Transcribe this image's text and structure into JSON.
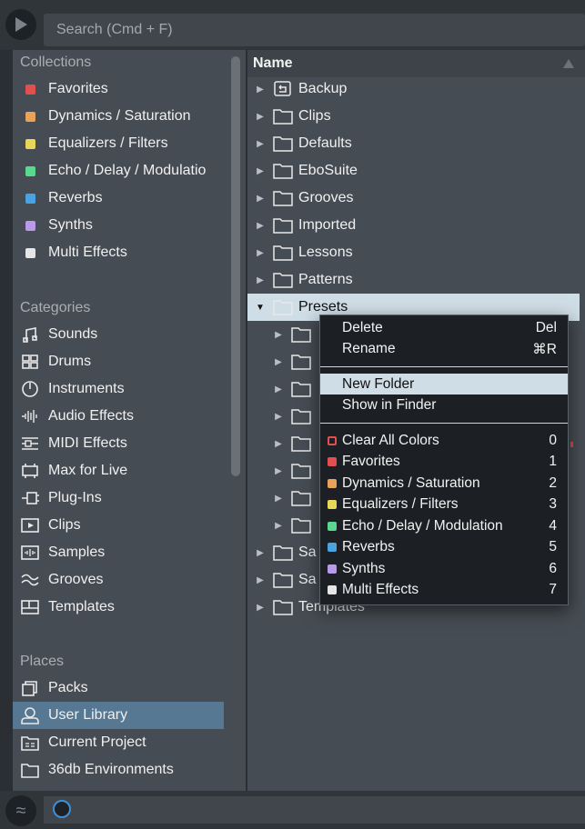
{
  "search": {
    "placeholder": "Search (Cmd + F)"
  },
  "collections": {
    "title": "Collections",
    "items": [
      {
        "label": "Favorites",
        "color": "#e05050"
      },
      {
        "label": "Dynamics / Saturation",
        "color": "#e8a25a"
      },
      {
        "label": "Equalizers / Filters",
        "color": "#e8d85a"
      },
      {
        "label": "Echo / Delay / Modulatio",
        "color": "#5ad88e"
      },
      {
        "label": "Reverbs",
        "color": "#4aa3e0"
      },
      {
        "label": "Synths",
        "color": "#b89ae8"
      },
      {
        "label": "Multi Effects",
        "color": "#e6e6e6"
      }
    ]
  },
  "categories": {
    "title": "Categories",
    "items": [
      {
        "label": "Sounds",
        "icon": "sounds-icon"
      },
      {
        "label": "Drums",
        "icon": "drums-icon"
      },
      {
        "label": "Instruments",
        "icon": "instruments-icon"
      },
      {
        "label": "Audio Effects",
        "icon": "audio-effects-icon"
      },
      {
        "label": "MIDI Effects",
        "icon": "midi-effects-icon"
      },
      {
        "label": "Max for Live",
        "icon": "max-for-live-icon"
      },
      {
        "label": "Plug-Ins",
        "icon": "plug-ins-icon"
      },
      {
        "label": "Clips",
        "icon": "clips-icon"
      },
      {
        "label": "Samples",
        "icon": "samples-icon"
      },
      {
        "label": "Grooves",
        "icon": "grooves-icon"
      },
      {
        "label": "Templates",
        "icon": "templates-icon"
      }
    ]
  },
  "places": {
    "title": "Places",
    "items": [
      {
        "label": "Packs",
        "icon": "packs-icon"
      },
      {
        "label": "User Library",
        "icon": "user-icon",
        "selected": true
      },
      {
        "label": "Current Project",
        "icon": "project-icon"
      },
      {
        "label": "36db Environments",
        "icon": "folder-icon"
      }
    ]
  },
  "files": {
    "header": "Name",
    "top": [
      {
        "label": "Backup",
        "icon": "backup-icon"
      },
      {
        "label": "Clips",
        "icon": "folder-icon"
      },
      {
        "label": "Defaults",
        "icon": "folder-icon"
      },
      {
        "label": "EboSuite",
        "icon": "folder-icon"
      },
      {
        "label": "Grooves",
        "icon": "folder-icon"
      },
      {
        "label": "Imported",
        "icon": "folder-icon"
      },
      {
        "label": "Lessons",
        "icon": "folder-icon"
      },
      {
        "label": "Patterns",
        "icon": "folder-icon"
      },
      {
        "label": "Presets",
        "icon": "folder-icon",
        "expanded": true,
        "selected": true
      }
    ],
    "children": [
      "",
      "",
      "",
      "",
      "",
      "",
      "",
      ""
    ],
    "bottom": [
      {
        "label": "Sa",
        "icon": "folder-icon"
      },
      {
        "label": "Sa",
        "icon": "folder-icon"
      },
      {
        "label": "Templates",
        "icon": "folder-icon"
      }
    ]
  },
  "context_menu": {
    "edit": [
      {
        "label": "Delete",
        "shortcut": "Del"
      },
      {
        "label": "Rename",
        "shortcut": "⌘R"
      }
    ],
    "file": [
      {
        "label": "New Folder",
        "hover": true
      },
      {
        "label": "Show in Finder"
      }
    ],
    "colors": [
      {
        "label": "Clear All Colors",
        "key": "0",
        "color": "#e05050"
      },
      {
        "label": "Favorites",
        "key": "1",
        "color": "#e05050"
      },
      {
        "label": "Dynamics / Saturation",
        "key": "2",
        "color": "#e8a25a"
      },
      {
        "label": "Equalizers / Filters",
        "key": "3",
        "color": "#e8d85a"
      },
      {
        "label": "Echo / Delay / Modulation",
        "key": "4",
        "color": "#5ad88e"
      },
      {
        "label": "Reverbs",
        "key": "5",
        "color": "#4aa3e0"
      },
      {
        "label": "Synths",
        "key": "6",
        "color": "#b89ae8"
      },
      {
        "label": "Multi Effects",
        "key": "7",
        "color": "#e6e6e6"
      }
    ]
  }
}
